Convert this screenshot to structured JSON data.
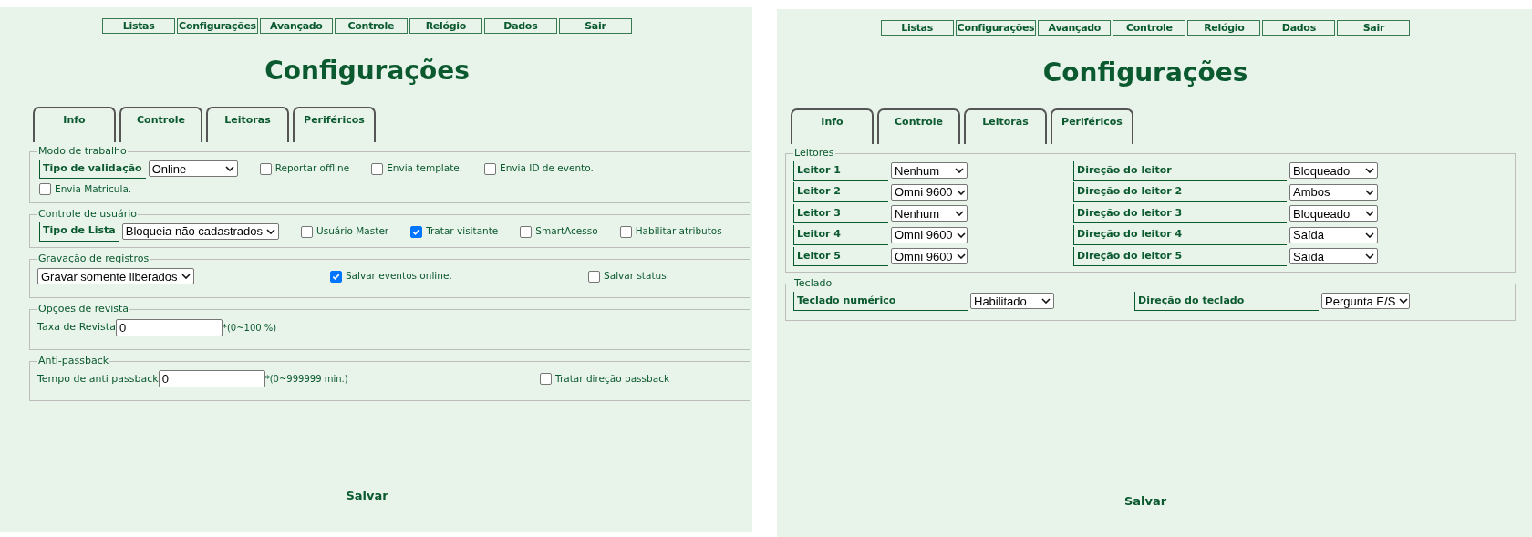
{
  "panels": [
    {
      "nav": [
        "Listas",
        "Configurações",
        "Avançado",
        "Controle",
        "Relógio",
        "Dados",
        "Sair"
      ],
      "title": "Configurações",
      "tabs": [
        "Info",
        "Controle",
        "Leitoras",
        "Periféricos"
      ],
      "sections": [
        {
          "legend": "Modo de trabalho",
          "kind": "form-row",
          "rows": [
            [
              {
                "kind": "labeled-select",
                "label": "Tipo de validação",
                "value": "Online"
              },
              {
                "kind": "checkbox",
                "label": "Reportar offline",
                "checked": false
              },
              {
                "kind": "checkbox",
                "label": "Envia template.",
                "checked": false
              },
              {
                "kind": "checkbox",
                "label": "Envia ID de evento.",
                "checked": false
              }
            ],
            [
              {
                "kind": "checkbox",
                "label": "Envia Matricula.",
                "checked": false
              }
            ]
          ]
        },
        {
          "legend": "Controle de usuário",
          "kind": "form-row",
          "rows": [
            [
              {
                "kind": "labeled-select",
                "label": "Tipo de Lista",
                "value": "Bloqueia não cadastrados"
              },
              {
                "kind": "checkbox",
                "label": "Usuário Master",
                "checked": false
              },
              {
                "kind": "checkbox",
                "label": "Tratar visitante",
                "checked": true
              },
              {
                "kind": "checkbox",
                "label": "SmartAcesso",
                "checked": false
              },
              {
                "kind": "checkbox",
                "label": "Habilitar atributos",
                "checked": false
              }
            ]
          ]
        },
        {
          "legend": "Gravação de registros",
          "kind": "spread",
          "items": [
            {
              "kind": "select",
              "value": "Gravar somente liberados"
            },
            {
              "kind": "checkbox",
              "label": "Salvar eventos online.",
              "checked": true
            },
            {
              "kind": "checkbox",
              "label": "Salvar status.",
              "checked": false
            }
          ]
        },
        {
          "legend": "Opções de revista",
          "kind": "spread",
          "items": [
            {
              "kind": "text-input",
              "label": "Taxa de Revista",
              "value": "0",
              "note": "*(0~100 %)"
            }
          ]
        },
        {
          "legend": "Anti-passback",
          "kind": "spread",
          "items": [
            {
              "kind": "text-input",
              "label": "Tempo de anti passback",
              "value": "0",
              "note": "*(0~999999 min.)"
            },
            {
              "kind": "checkbox",
              "label": "Tratar direção passback",
              "checked": false
            }
          ]
        }
      ],
      "save": "Salvar"
    },
    {
      "nav": [
        "Listas",
        "Configurações",
        "Avançado",
        "Controle",
        "Relógio",
        "Dados",
        "Sair"
      ],
      "title": "Configurações",
      "tabs": [
        "Info",
        "Controle",
        "Leitoras",
        "Periféricos"
      ],
      "sections": [
        {
          "legend": "Leitores",
          "kind": "reader-grid",
          "items": [
            {
              "kind": "labeled-select",
              "label": "Leitor 1",
              "value": "Nenhum"
            },
            {
              "kind": "labeled-select",
              "label": "Direção do leitor",
              "value": "Bloqueado"
            },
            {
              "kind": "labeled-select",
              "label": "Leitor 2",
              "value": "Omni 9600"
            },
            {
              "kind": "labeled-select",
              "label": "Direção do leitor 2",
              "value": "Ambos"
            },
            {
              "kind": "labeled-select",
              "label": "Leitor 3",
              "value": "Nenhum"
            },
            {
              "kind": "labeled-select",
              "label": "Direção do leitor 3",
              "value": "Bloqueado"
            },
            {
              "kind": "labeled-select",
              "label": "Leitor 4",
              "value": "Omni 9600"
            },
            {
              "kind": "labeled-select",
              "label": "Direção do leitor 4",
              "value": "Saída"
            },
            {
              "kind": "labeled-select",
              "label": "Leitor 5",
              "value": "Omni 9600"
            },
            {
              "kind": "labeled-select",
              "label": "Direção do leitor 5",
              "value": "Saída"
            }
          ]
        },
        {
          "legend": "Teclado",
          "kind": "pair-grid",
          "items": [
            {
              "kind": "labeled-select",
              "label": "Teclado numérico",
              "value": "Habilitado"
            },
            {
              "kind": "labeled-select",
              "label": "Direção do teclado",
              "value": "Pergunta E/S"
            }
          ]
        }
      ],
      "save": "Salvar"
    }
  ]
}
